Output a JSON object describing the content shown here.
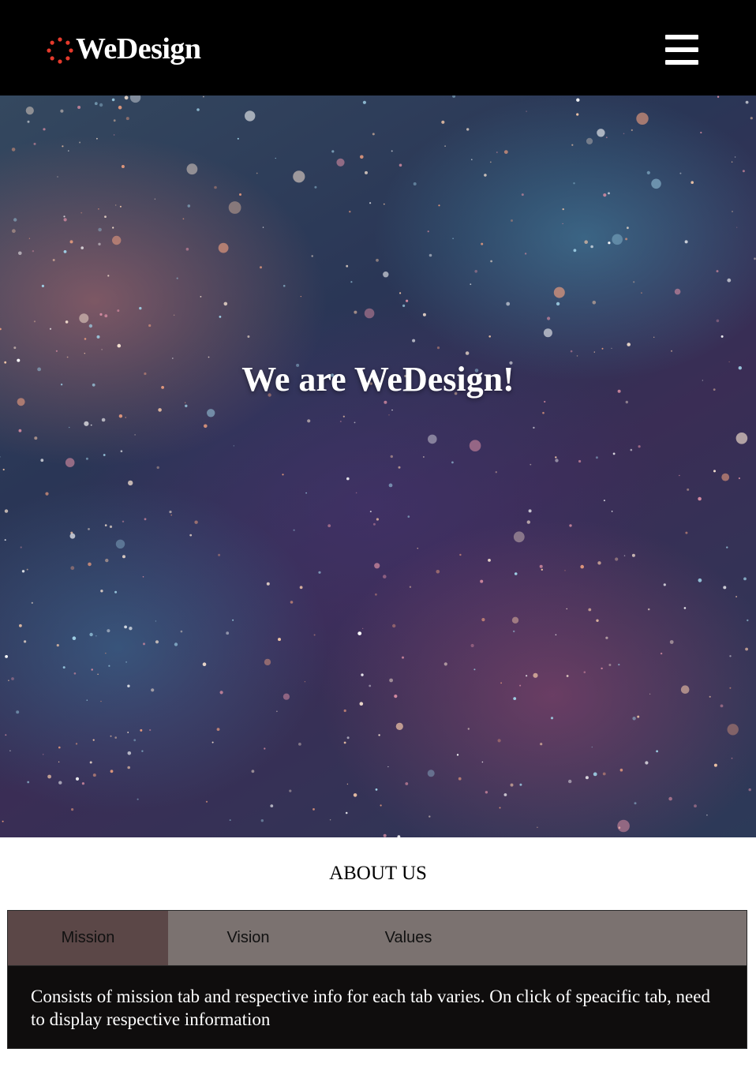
{
  "header": {
    "logo_text": "WeDesign",
    "logo_icon": "dotted-circle-logo-icon",
    "menu_icon": "hamburger-menu-icon",
    "background_color": "#000000",
    "logo_dot_color": "#e53a2c"
  },
  "hero": {
    "title": "We are WeDesign!",
    "background_description_colors": [
      "#2a3656",
      "#3a2d55",
      "#be6e6e"
    ]
  },
  "about": {
    "heading": "ABOUT US",
    "tabs": [
      {
        "label": "Mission",
        "active": true
      },
      {
        "label": "Vision",
        "active": false
      },
      {
        "label": "Values",
        "active": false
      }
    ],
    "content": "Consists of mission tab and respective info for each tab varies. On click of speacific tab, need to display respective information",
    "active_tab_color": "#5b4747",
    "tab_bar_color": "#7b7270",
    "content_background": "#0f0d0d"
  }
}
